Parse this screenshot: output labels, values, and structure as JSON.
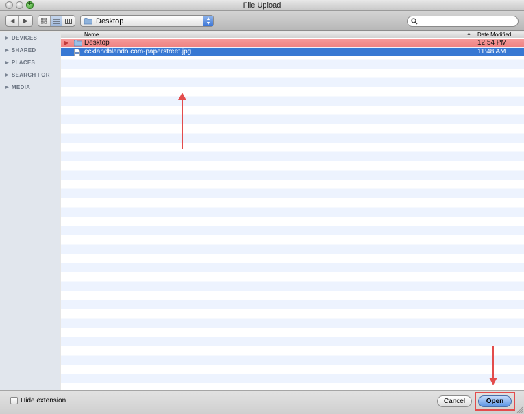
{
  "window": {
    "title": "File Upload"
  },
  "toolbar": {
    "nav_back": "◀",
    "nav_forward": "▶",
    "location": "Desktop",
    "search_placeholder": ""
  },
  "sidebar": {
    "items": [
      {
        "label": "DEVICES"
      },
      {
        "label": "SHARED"
      },
      {
        "label": "PLACES"
      },
      {
        "label": "SEARCH FOR"
      },
      {
        "label": "MEDIA"
      }
    ]
  },
  "list": {
    "col_name": "Name",
    "col_date": "Date Modified",
    "rows": [
      {
        "name": "Desktop",
        "date": "12:54 PM",
        "kind": "folder"
      },
      {
        "name": "ecklandblando.com-paperstreet.jpg",
        "date": "11:48 AM",
        "kind": "image"
      }
    ]
  },
  "bottom": {
    "hide_extension": "Hide extension",
    "cancel": "Cancel",
    "open": "Open"
  },
  "colors": {
    "selection_blue": "#3878d3",
    "highlight_red": "#ee8080",
    "annotation_red": "#e34c4c"
  }
}
